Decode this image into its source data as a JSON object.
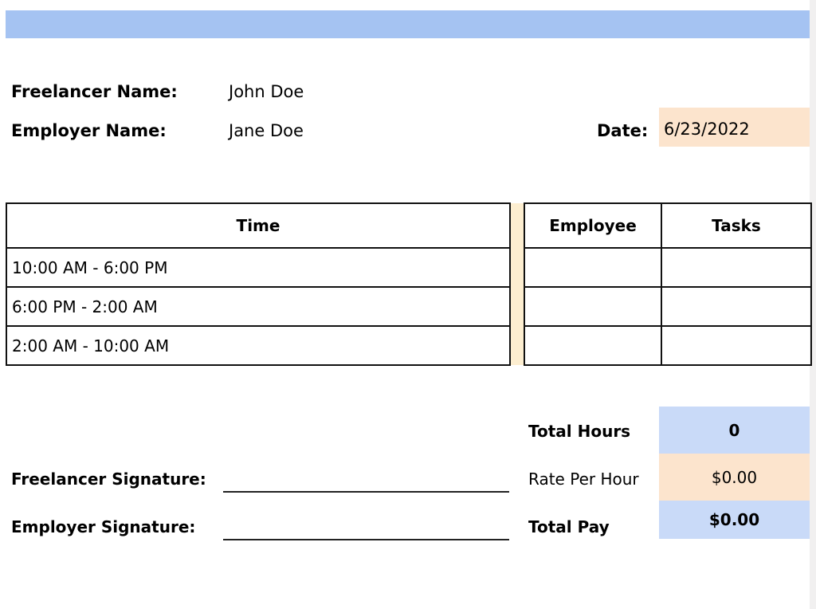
{
  "colors": {
    "header_band": "#a5c3f2",
    "highlight_blue": "#c9daf8",
    "highlight_peach": "#fce4cd",
    "gap_column": "#fdeed0"
  },
  "info": {
    "freelancer_label": "Freelancer Name:",
    "freelancer_value": "John Doe",
    "employer_label": "Employer Name:",
    "employer_value": "Jane Doe",
    "date_label": "Date:",
    "date_value": "6/23/2022"
  },
  "schedule": {
    "headers": {
      "time": "Time",
      "employee": "Employee",
      "tasks": "Tasks"
    },
    "rows": [
      {
        "time": "10:00 AM - 6:00 PM",
        "employee": "",
        "tasks": ""
      },
      {
        "time": "6:00 PM - 2:00 AM",
        "employee": "",
        "tasks": ""
      },
      {
        "time": "2:00 AM - 10:00 AM",
        "employee": "",
        "tasks": ""
      }
    ]
  },
  "signatures": {
    "freelancer_label": "Freelancer Signature:",
    "employer_label": "Employer Signature:"
  },
  "summary": {
    "total_hours_label": "Total Hours",
    "total_hours_value": "0",
    "rate_label": "Rate Per Hour",
    "rate_value": "$0.00",
    "total_pay_label": "Total Pay",
    "total_pay_value": "$0.00"
  }
}
